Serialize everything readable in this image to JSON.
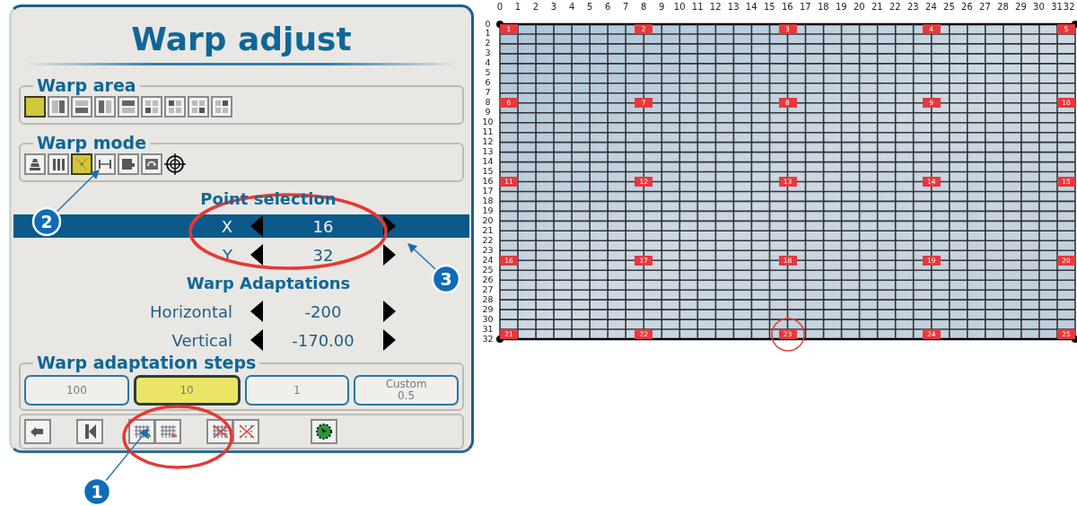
{
  "dialog": {
    "title": "Warp adjust",
    "warp_area": {
      "label": "Warp area",
      "options": [
        {
          "selected": true
        },
        {
          "selected": false
        },
        {
          "selected": false
        },
        {
          "selected": false
        },
        {
          "selected": false
        },
        {
          "selected": false
        },
        {
          "selected": false
        },
        {
          "selected": false
        },
        {
          "selected": false
        }
      ]
    },
    "warp_mode": {
      "label": "Warp mode",
      "options": [
        {
          "selected": false
        },
        {
          "selected": false
        },
        {
          "selected": true
        },
        {
          "selected": false
        },
        {
          "selected": false
        },
        {
          "selected": false
        },
        {
          "selected": false
        }
      ]
    },
    "point_selection": {
      "label": "Point selection",
      "rows": [
        {
          "label": "X",
          "value": "16",
          "selected": true
        },
        {
          "label": "Y",
          "value": "32",
          "selected": false
        }
      ]
    },
    "warp_adaptations": {
      "label": "Warp Adaptations",
      "rows": [
        {
          "label": "Horizontal",
          "value": "-200"
        },
        {
          "label": "Vertical",
          "value": "-170.00"
        }
      ]
    },
    "steps": {
      "label": "Warp adaptation steps",
      "options": [
        {
          "label": "100",
          "selected": false
        },
        {
          "label": "10",
          "selected": true
        },
        {
          "label": "1",
          "selected": false
        },
        {
          "label": "Custom",
          "value": "0.5",
          "selected": false
        }
      ]
    }
  },
  "callouts": [
    {
      "number": "1"
    },
    {
      "number": "2"
    },
    {
      "number": "3"
    }
  ],
  "grid": {
    "column_labels": [
      "0",
      "1",
      "2",
      "3",
      "4",
      "5",
      "6",
      "7",
      "8",
      "9",
      "10",
      "11",
      "12",
      "13",
      "14",
      "15",
      "16",
      "17",
      "18",
      "19",
      "20",
      "21",
      "22",
      "23",
      "24",
      "25",
      "26",
      "27",
      "28",
      "29",
      "30",
      "31",
      "32"
    ],
    "row_labels": [
      "0",
      "1",
      "2",
      "3",
      "4",
      "5",
      "6",
      "7",
      "8",
      "9",
      "10",
      "11",
      "12",
      "13",
      "14",
      "15",
      "16",
      "17",
      "18",
      "19",
      "20",
      "21",
      "22",
      "23",
      "24",
      "25",
      "26",
      "27",
      "28",
      "29",
      "30",
      "31",
      "32"
    ],
    "markers": [
      {
        "label": "1",
        "circled": false
      },
      {
        "label": "2",
        "circled": false
      },
      {
        "label": "3",
        "circled": false
      },
      {
        "label": "4",
        "circled": false
      },
      {
        "label": "5",
        "circled": false
      },
      {
        "label": "6",
        "circled": false
      },
      {
        "label": "7",
        "circled": false
      },
      {
        "label": "8",
        "circled": false
      },
      {
        "label": "9",
        "circled": false
      },
      {
        "label": "10",
        "circled": false
      },
      {
        "label": "11",
        "circled": false
      },
      {
        "label": "12",
        "circled": false
      },
      {
        "label": "13",
        "circled": false
      },
      {
        "label": "14",
        "circled": false
      },
      {
        "label": "15",
        "circled": false
      },
      {
        "label": "16",
        "circled": false
      },
      {
        "label": "17",
        "circled": false
      },
      {
        "label": "18",
        "circled": false
      },
      {
        "label": "19",
        "circled": false
      },
      {
        "label": "20",
        "circled": false
      },
      {
        "label": "21",
        "circled": false
      },
      {
        "label": "22",
        "circled": false
      },
      {
        "label": "23",
        "circled": true
      },
      {
        "label": "24",
        "circled": false
      },
      {
        "label": "25",
        "circled": false
      }
    ]
  }
}
